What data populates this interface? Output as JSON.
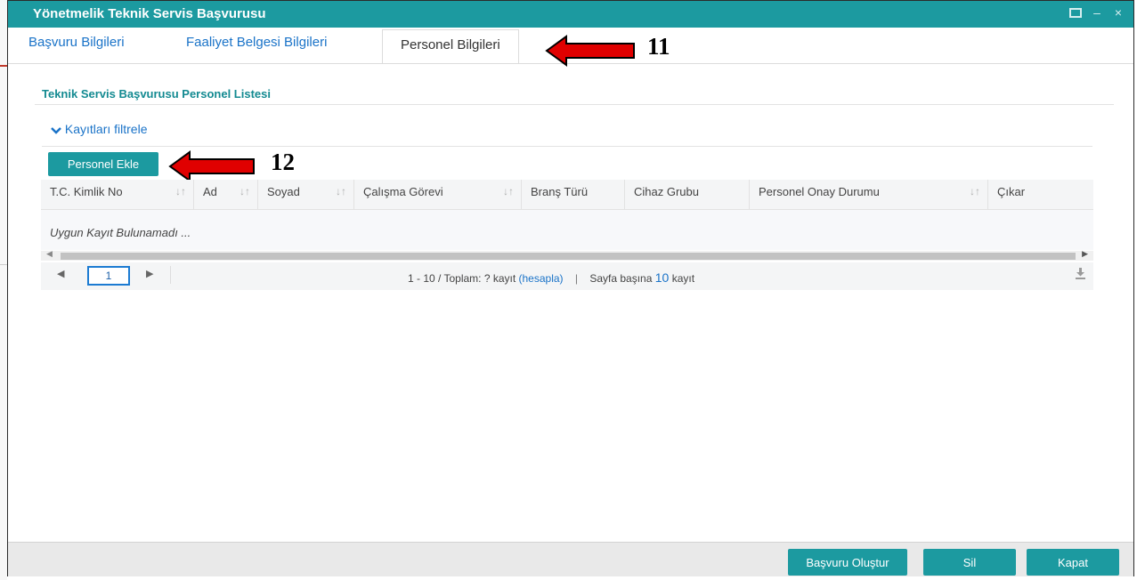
{
  "window": {
    "title": "Yönetmelik Teknik Servis Başvurusu",
    "controls": [
      "maximize-icon",
      "minimize-icon",
      "close-icon"
    ],
    "minimize_glyph": "–",
    "close_glyph": "×"
  },
  "tabs": [
    {
      "label": "Başvuru Bilgileri",
      "active": false
    },
    {
      "label": "Faaliyet Belgesi Bilgileri",
      "active": false
    },
    {
      "label": "Personel Bilgileri",
      "active": true
    }
  ],
  "section_title": "Teknik Servis Başvurusu Personel Listesi",
  "filter_label": "Kayıtları filtrele",
  "add_button_label": "Personel Ekle",
  "table": {
    "columns": [
      {
        "label": "T.C. Kimlik No",
        "sortable": true
      },
      {
        "label": "Ad",
        "sortable": true
      },
      {
        "label": "Soyad",
        "sortable": true
      },
      {
        "label": "Çalışma Görevi",
        "sortable": true
      },
      {
        "label": "Branş Türü",
        "sortable": false
      },
      {
        "label": "Cihaz Grubu",
        "sortable": false
      },
      {
        "label": "Personel Onay Durumu",
        "sortable": true
      },
      {
        "label": "Çıkar",
        "sortable": false
      }
    ],
    "sort_glyph": "↓↑",
    "empty_message": "Uygun Kayıt Bulunamadı ..."
  },
  "pager": {
    "current_page": "1",
    "range_text": "1 - 10 / Toplam: ? kayıt",
    "calc_link": "(hesapla)",
    "separator": "|",
    "per_page_prefix": "Sayfa başına",
    "per_page_value": "10",
    "per_page_suffix": "kayıt"
  },
  "footer": {
    "create_label": "Başvuru Oluştur",
    "delete_label": "Sil",
    "close_label": "Kapat"
  },
  "annotations": [
    {
      "number": "11",
      "target": "Personel Bilgileri tab"
    },
    {
      "number": "12",
      "target": "Personel Ekle button"
    }
  ],
  "colors": {
    "accent": "#1c9aa0",
    "link": "#1a73c8",
    "section_title": "#138a91",
    "annotation_arrow": "#e00000"
  }
}
